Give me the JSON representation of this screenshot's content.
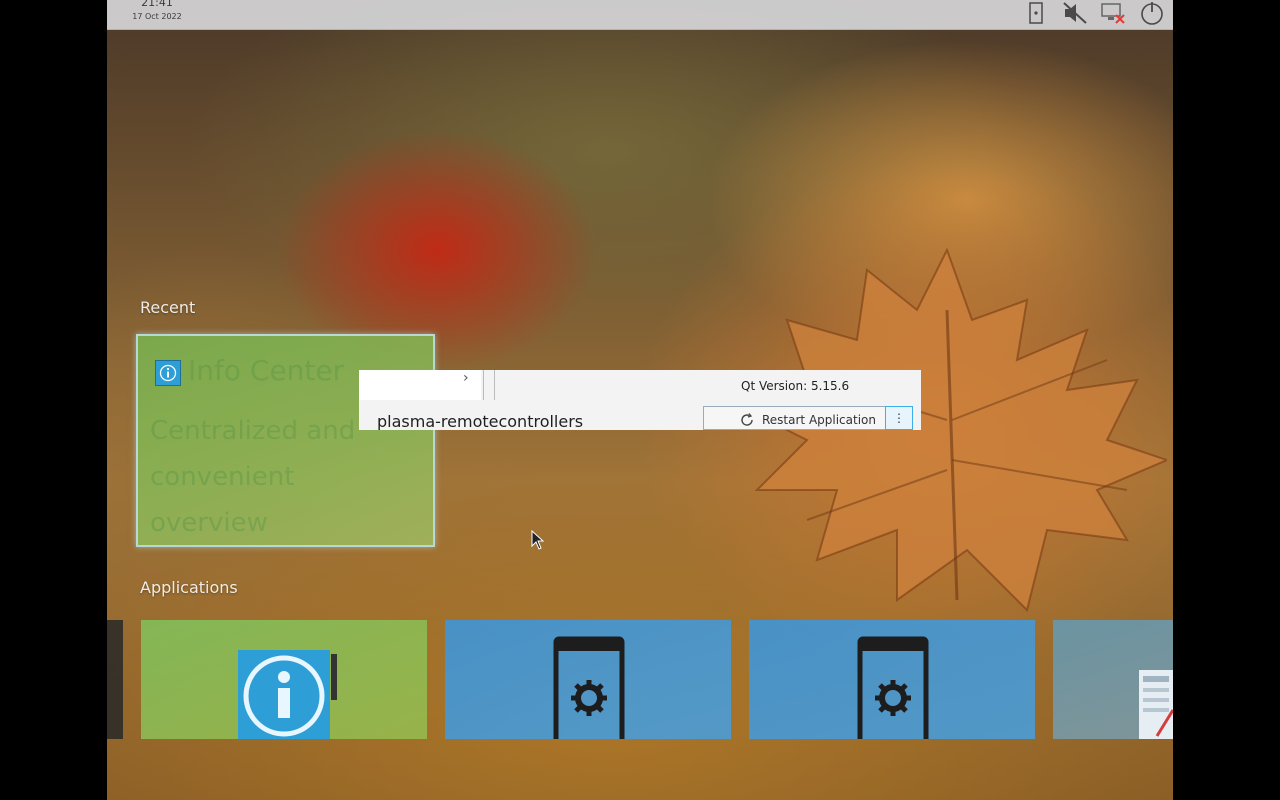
{
  "panel": {
    "clock_time": "21:41",
    "clock_date": "17 Oct 2022",
    "tray": [
      "tablet-icon",
      "speaker-muted-icon",
      "network-disconnected-icon",
      "power-icon"
    ]
  },
  "sections": {
    "recent_label": "Recent",
    "applications_label": "Applications"
  },
  "recent": [
    {
      "name": "Info Center",
      "description": "Centralized and convenient overview",
      "icon": "info-icon",
      "accent": "#2e9fd6"
    }
  ],
  "applications": [
    {
      "icon": "info-icon"
    },
    {
      "icon": "phone-settings-icon"
    },
    {
      "icon": "phone-settings-icon"
    },
    {
      "icon": "document-icon"
    }
  ],
  "window": {
    "qt_version": "Qt Version: 5.15.6",
    "module_name": "plasma-remotecontrollers",
    "restart_label": "Restart Application",
    "menu_label": "⋮"
  },
  "colors": {
    "panel_bg": "#d6d6d8",
    "tile_green": "#82be5a",
    "tile_blue": "#3c96dc",
    "focus_border": "#bee1eb",
    "accent": "#3daee9"
  }
}
